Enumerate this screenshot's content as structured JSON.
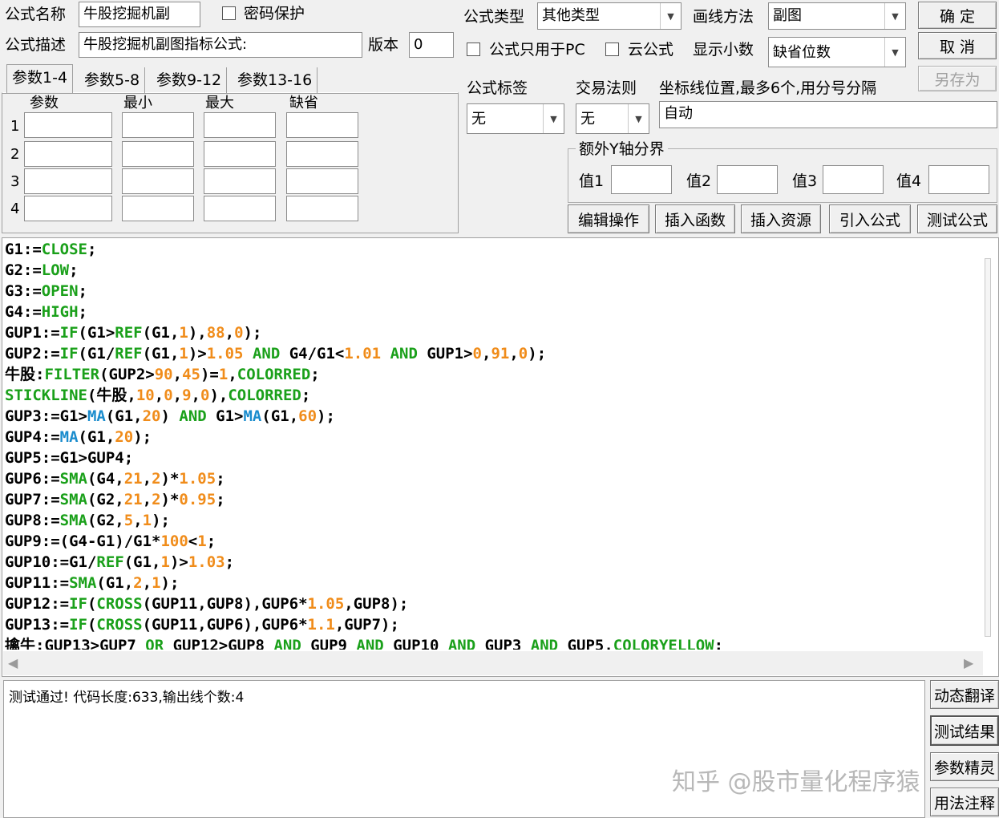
{
  "form": {
    "name_label": "公式名称",
    "name_value": "牛股挖掘机副",
    "password_label": "密码保护",
    "desc_label": "公式描述",
    "desc_value": "牛股挖掘机副图指标公式:",
    "version_label": "版本",
    "version_value": "0",
    "type_label": "公式类型",
    "type_value": "其他类型",
    "draw_label": "画线方法",
    "draw_value": "副图",
    "pc_only_label": "公式只用于PC",
    "cloud_label": "云公式",
    "decimal_label": "显示小数",
    "decimal_value": "缺省位数",
    "tag_label": "公式标签",
    "tag_value": "无",
    "rule_label": "交易法则",
    "rule_value": "无",
    "axis_label": "坐标线位置,最多6个,用分号分隔",
    "axis_value": "自动",
    "yaxis_group": "额外Y轴分界",
    "y_labels": [
      "值1",
      "值2",
      "值3",
      "值4"
    ]
  },
  "buttons": {
    "ok": "确 定",
    "cancel": "取 消",
    "save_as": "另存为",
    "edit": "编辑操作",
    "insert_func": "插入函数",
    "insert_res": "插入资源",
    "import": "引入公式",
    "test": "测试公式",
    "dyn_translate": "动态翻译",
    "test_result": "测试结果",
    "param_wizard": "参数精灵",
    "usage": "用法注释"
  },
  "params": {
    "tabs": [
      "参数1-4",
      "参数5-8",
      "参数9-12",
      "参数13-16"
    ],
    "headers": [
      "参数",
      "最小",
      "最大",
      "缺省"
    ],
    "rows": [
      "1",
      "2",
      "3",
      "4"
    ]
  },
  "code_lines": [
    [
      [
        "G1:=",
        ""
      ],
      [
        "CLOSE",
        "f"
      ],
      [
        ";",
        ""
      ]
    ],
    [
      [
        "G2:=",
        ""
      ],
      [
        "LOW",
        "f"
      ],
      [
        ";",
        ""
      ]
    ],
    [
      [
        "G3:=",
        ""
      ],
      [
        "OPEN",
        "f"
      ],
      [
        ";",
        ""
      ]
    ],
    [
      [
        "G4:=",
        ""
      ],
      [
        "HIGH",
        "f"
      ],
      [
        ";",
        ""
      ]
    ],
    [
      [
        "GUP1:=",
        ""
      ],
      [
        "IF",
        "f"
      ],
      [
        "(G1>",
        ""
      ],
      [
        "REF",
        "f"
      ],
      [
        "(G1,",
        ""
      ],
      [
        "1",
        "n"
      ],
      [
        "),",
        ""
      ],
      [
        "88",
        "n"
      ],
      [
        ",",
        ""
      ],
      [
        "0",
        "n"
      ],
      [
        ");",
        ""
      ]
    ],
    [
      [
        "GUP2:=",
        ""
      ],
      [
        "IF",
        "f"
      ],
      [
        "(G1/",
        ""
      ],
      [
        "REF",
        "f"
      ],
      [
        "(G1,",
        ""
      ],
      [
        "1",
        "n"
      ],
      [
        ")>",
        ""
      ],
      [
        "1.05",
        "n"
      ],
      [
        " ",
        ""
      ],
      [
        "AND",
        "f"
      ],
      [
        " G4/G1<",
        ""
      ],
      [
        "1.01",
        "n"
      ],
      [
        " ",
        ""
      ],
      [
        "AND",
        "f"
      ],
      [
        " GUP1>",
        ""
      ],
      [
        "0",
        "n"
      ],
      [
        ",",
        ""
      ],
      [
        "91",
        "n"
      ],
      [
        ",",
        ""
      ],
      [
        "0",
        "n"
      ],
      [
        ");",
        ""
      ]
    ],
    [
      [
        "牛股:",
        ""
      ],
      [
        "FILTER",
        "f"
      ],
      [
        "(GUP2>",
        ""
      ],
      [
        "90",
        "n"
      ],
      [
        ",",
        ""
      ],
      [
        "45",
        "n"
      ],
      [
        ")=",
        ""
      ],
      [
        "1",
        "n"
      ],
      [
        ",",
        ""
      ],
      [
        "COLORRED",
        "f"
      ],
      [
        ";",
        ""
      ]
    ],
    [
      [
        "STICKLINE",
        "f"
      ],
      [
        "(牛股,",
        ""
      ],
      [
        "10",
        "n"
      ],
      [
        ",",
        ""
      ],
      [
        "0",
        "n"
      ],
      [
        ",",
        ""
      ],
      [
        "9",
        "n"
      ],
      [
        ",",
        ""
      ],
      [
        "0",
        "n"
      ],
      [
        "),",
        ""
      ],
      [
        "COLORRED",
        "f"
      ],
      [
        ";",
        ""
      ]
    ],
    [
      [
        "GUP3:=G1>",
        ""
      ],
      [
        "MA",
        "b"
      ],
      [
        "(G1,",
        ""
      ],
      [
        "20",
        "n"
      ],
      [
        ") ",
        ""
      ],
      [
        "AND",
        "f"
      ],
      [
        " G1>",
        ""
      ],
      [
        "MA",
        "b"
      ],
      [
        "(G1,",
        ""
      ],
      [
        "60",
        "n"
      ],
      [
        ");",
        ""
      ]
    ],
    [
      [
        "GUP4:=",
        ""
      ],
      [
        "MA",
        "b"
      ],
      [
        "(G1,",
        ""
      ],
      [
        "20",
        "n"
      ],
      [
        ");",
        ""
      ]
    ],
    [
      [
        "GUP5:=G1>GUP4;",
        ""
      ]
    ],
    [
      [
        "GUP6:=",
        ""
      ],
      [
        "SMA",
        "f"
      ],
      [
        "(G4,",
        ""
      ],
      [
        "21",
        "n"
      ],
      [
        ",",
        ""
      ],
      [
        "2",
        "n"
      ],
      [
        ")*",
        ""
      ],
      [
        "1.05",
        "n"
      ],
      [
        ";",
        ""
      ]
    ],
    [
      [
        "GUP7:=",
        ""
      ],
      [
        "SMA",
        "f"
      ],
      [
        "(G2,",
        ""
      ],
      [
        "21",
        "n"
      ],
      [
        ",",
        ""
      ],
      [
        "2",
        "n"
      ],
      [
        ")*",
        ""
      ],
      [
        "0.95",
        "n"
      ],
      [
        ";",
        ""
      ]
    ],
    [
      [
        "GUP8:=",
        ""
      ],
      [
        "SMA",
        "f"
      ],
      [
        "(G2,",
        ""
      ],
      [
        "5",
        "n"
      ],
      [
        ",",
        ""
      ],
      [
        "1",
        "n"
      ],
      [
        ");",
        ""
      ]
    ],
    [
      [
        "GUP9:=(G4-G1)/G1*",
        ""
      ],
      [
        "100",
        "n"
      ],
      [
        "<",
        ""
      ],
      [
        "1",
        "n"
      ],
      [
        ";",
        ""
      ]
    ],
    [
      [
        "GUP10:=G1/",
        ""
      ],
      [
        "REF",
        "f"
      ],
      [
        "(G1,",
        ""
      ],
      [
        "1",
        "n"
      ],
      [
        ")>",
        ""
      ],
      [
        "1.03",
        "n"
      ],
      [
        ";",
        ""
      ]
    ],
    [
      [
        "GUP11:=",
        ""
      ],
      [
        "SMA",
        "f"
      ],
      [
        "(G1,",
        ""
      ],
      [
        "2",
        "n"
      ],
      [
        ",",
        ""
      ],
      [
        "1",
        "n"
      ],
      [
        ");",
        ""
      ]
    ],
    [
      [
        "GUP12:=",
        ""
      ],
      [
        "IF",
        "f"
      ],
      [
        "(",
        ""
      ],
      [
        "CROSS",
        "f"
      ],
      [
        "(GUP11,GUP8),GUP6*",
        ""
      ],
      [
        "1.05",
        "n"
      ],
      [
        ",GUP8);",
        ""
      ]
    ],
    [
      [
        "GUP13:=",
        ""
      ],
      [
        "IF",
        "f"
      ],
      [
        "(",
        ""
      ],
      [
        "CROSS",
        "f"
      ],
      [
        "(GUP11,GUP6),GUP6*",
        ""
      ],
      [
        "1.1",
        "n"
      ],
      [
        ",GUP7);",
        ""
      ]
    ],
    [
      [
        "擒牛:GUP13>GUP7 ",
        ""
      ],
      [
        "OR",
        "f"
      ],
      [
        " GUP12>GUP8 ",
        ""
      ],
      [
        "AND",
        "f"
      ],
      [
        " GUP9 ",
        ""
      ],
      [
        "AND",
        "f"
      ],
      [
        " GUP10 ",
        ""
      ],
      [
        "AND",
        "f"
      ],
      [
        " GUP3 ",
        ""
      ],
      [
        "AND",
        "f"
      ],
      [
        " GUP5,",
        ""
      ],
      [
        "COLORYELLOW",
        "f"
      ],
      [
        ";",
        ""
      ]
    ]
  ],
  "output_text": "测试通过! 代码长度:633,输出线个数:4",
  "watermark": "知乎 @股市量化程序猿",
  "colors": {
    "keyword": "#1aa01a",
    "number": "#f08c1a",
    "ma_function": "#1a8ccd"
  },
  "icons": [
    "checkbox-icon",
    "dropdown-arrow-icon",
    "scroll-left-icon",
    "scroll-right-icon"
  ]
}
